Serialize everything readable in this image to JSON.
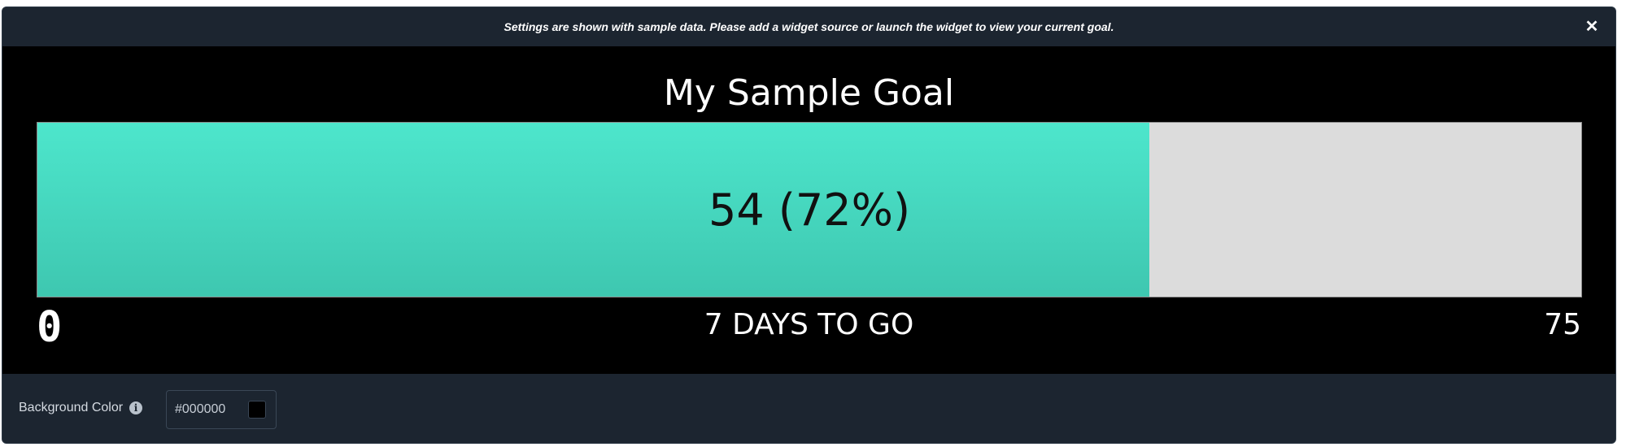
{
  "notice": {
    "text": "Settings are shown with sample data. Please add a widget source or launch the widget to view your current goal.",
    "close_icon": "close-icon"
  },
  "goal": {
    "title": "My Sample Goal",
    "current": 54,
    "target": 75,
    "progress_fraction": 0.72,
    "progress_label": "54 (72%)",
    "min_label": "0",
    "max_label": "75",
    "days_label": "7 DAYS TO GO",
    "fill_color": "#45DEC6",
    "track_color": "#DCDCDC"
  },
  "settings": {
    "background_color_label": "Background Color",
    "info_icon": "info-icon",
    "background_color_value": "#000000"
  }
}
